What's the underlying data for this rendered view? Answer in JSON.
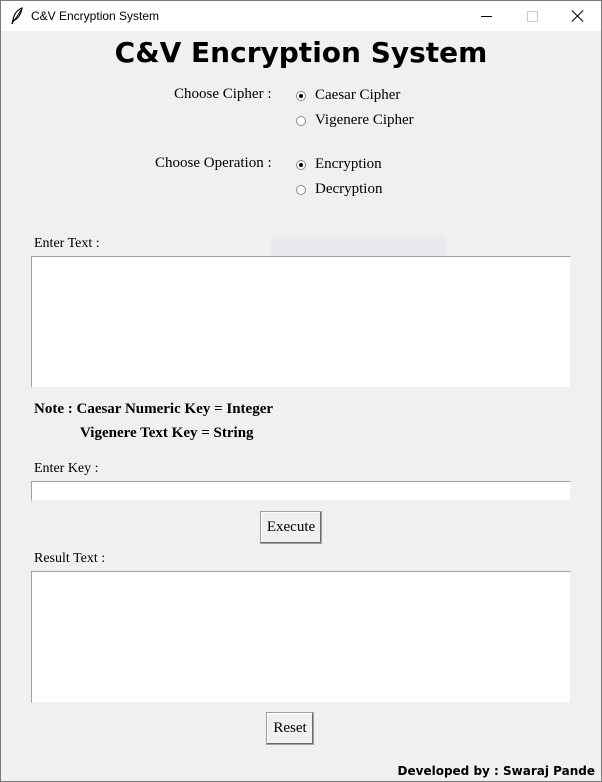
{
  "window": {
    "title": "C&V Encryption System",
    "icon": "feather-icon"
  },
  "header": {
    "title": "C&V Encryption System"
  },
  "cipher": {
    "label": "Choose Cipher :",
    "options": [
      {
        "label": "Caesar Cipher",
        "selected": true
      },
      {
        "label": "Vigenere Cipher",
        "selected": false
      }
    ]
  },
  "operation": {
    "label": "Choose Operation :",
    "options": [
      {
        "label": "Encryption",
        "selected": true
      },
      {
        "label": "Decryption",
        "selected": false
      }
    ]
  },
  "input": {
    "label": "Enter Text :",
    "value": ""
  },
  "note": {
    "line1": "Note : Caesar Numeric Key = Integer",
    "line2": "Vigenere Text Key = String"
  },
  "key": {
    "label": "Enter Key :",
    "value": ""
  },
  "actions": {
    "execute": "Execute",
    "reset": "Reset"
  },
  "result": {
    "label": "Result Text :",
    "value": ""
  },
  "footer": {
    "credit": "Developed by : Swaraj Pande"
  },
  "colors": {
    "window_bg": "#f0f0f0",
    "titlebar_bg": "#ffffff",
    "field_bg": "#ffffff"
  }
}
